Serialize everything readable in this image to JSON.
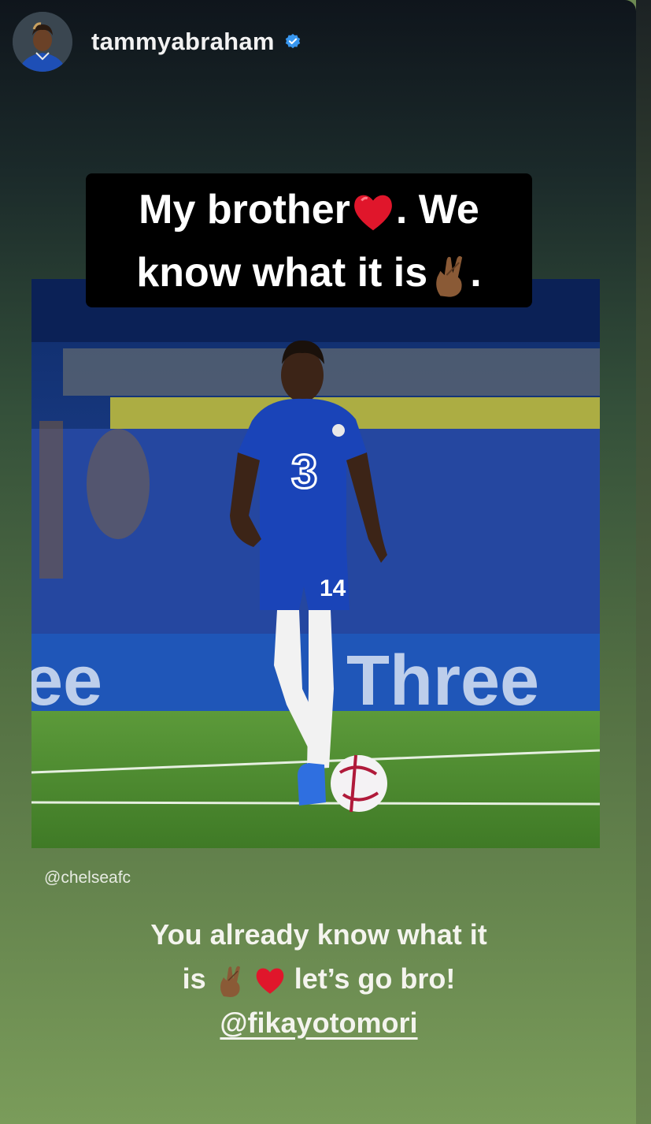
{
  "story": {
    "username": "tammyabraham",
    "verified": true,
    "header_icons": [
      "avatar",
      "verified-badge-icon"
    ]
  },
  "top_caption": {
    "line1_text": "My brother",
    "line1_emoji": "red-heart-icon",
    "line1_tail": ". We",
    "line2_text": "know what it is",
    "line2_emoji": "crossed-fingers-icon",
    "line2_tail": "."
  },
  "photo": {
    "subject": "footballer in blue kit with ball",
    "shirt_number": "14",
    "board_text": "Three"
  },
  "credit": "@chelseafc",
  "bottom_caption": {
    "line1": "You already know what it",
    "line2_prefix": "is",
    "line2_emojis": [
      "crossed-fingers-icon",
      "red-heart-icon"
    ],
    "line2_suffix": "let’s go bro!",
    "mention": "@fikayotomori"
  },
  "colors": {
    "verified_blue": "#3897f0",
    "heart_red": "#e0162b",
    "kit_blue": "#1a44b8"
  }
}
